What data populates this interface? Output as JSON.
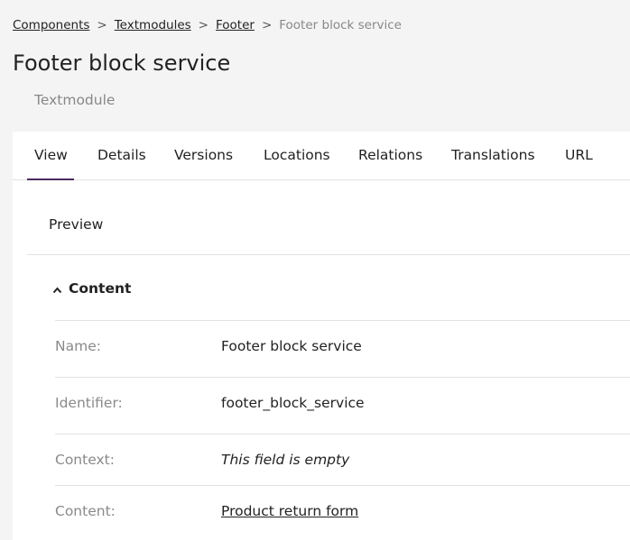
{
  "breadcrumb": {
    "items": [
      "Components",
      "Textmodules",
      "Footer"
    ],
    "separator": ">",
    "current": "Footer block service"
  },
  "header": {
    "title": "Footer block service",
    "subtitle": "Textmodule"
  },
  "tabs": [
    {
      "label": "View",
      "active": true
    },
    {
      "label": "Details"
    },
    {
      "label": "Versions"
    },
    {
      "label": "Locations"
    },
    {
      "label": "Relations"
    },
    {
      "label": "Translations"
    },
    {
      "label": "URL"
    }
  ],
  "preview": {
    "label": "Preview"
  },
  "content_section": {
    "title": "Content",
    "icon": "chevron-up-icon",
    "fields": [
      {
        "label": "Name:",
        "value": "Footer block service"
      },
      {
        "label": "Identifier:",
        "value": "footer_block_service"
      },
      {
        "label": "Context:",
        "value": "This field is empty"
      },
      {
        "label": "Content:",
        "value": "Product return form"
      }
    ]
  },
  "colors": {
    "background": "#f4f4f4",
    "panel": "#ffffff",
    "active_tab_underline": "#4b2a5e",
    "muted_text": "#8a8a8a"
  }
}
